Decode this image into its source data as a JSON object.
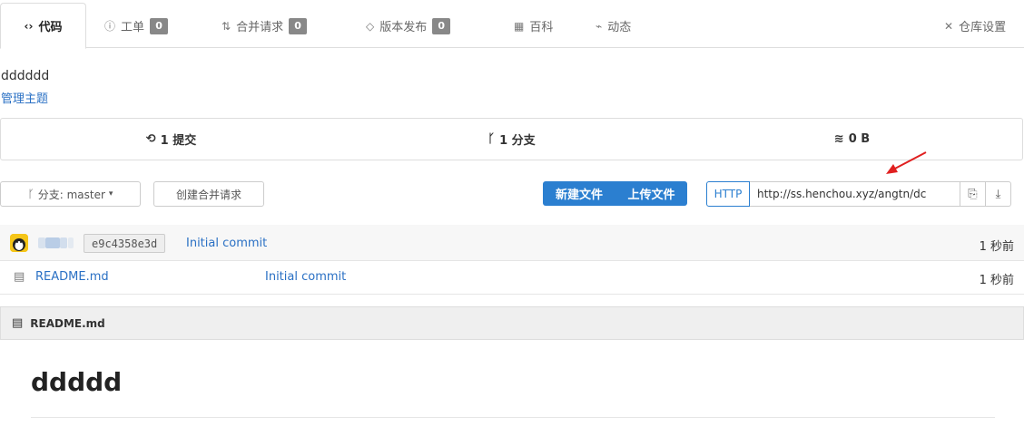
{
  "tabs": [
    {
      "icon": "code-icon",
      "glyph": "‹›",
      "label": "代码",
      "active": true
    },
    {
      "icon": "issue-icon",
      "glyph": "ⓘ",
      "label": "工单",
      "count": "0"
    },
    {
      "icon": "pull-request-icon",
      "glyph": "⇅",
      "label": "合并请求",
      "count": "0"
    },
    {
      "icon": "tag-icon",
      "glyph": "◇",
      "label": "版本发布",
      "count": "0"
    },
    {
      "icon": "wiki-icon",
      "glyph": "▦",
      "label": "百科"
    },
    {
      "icon": "activity-icon",
      "glyph": "⌁",
      "label": "动态"
    }
  ],
  "settings": {
    "icon": "tools-icon",
    "glyph": "✕",
    "label": "仓库设置"
  },
  "repo": {
    "description": "dddddd",
    "manage_topics": "管理主题"
  },
  "stats": {
    "commits": {
      "icon": "history-icon",
      "label": "1 提交"
    },
    "branches": {
      "icon": "branch-icon",
      "label": "1 分支"
    },
    "size": {
      "icon": "database-icon",
      "label": "0 B"
    }
  },
  "toolbar": {
    "branch_label": "分支: master",
    "create_pr": "创建合并请求",
    "new_file": "新建文件",
    "upload_file": "上传文件",
    "clone_protocol": "HTTP",
    "clone_url": "http://ss.henchou.xyz/angtn/dc"
  },
  "latest_commit": {
    "sha": "e9c4358e3d",
    "message": "Initial commit",
    "time": "1 秒前"
  },
  "files": [
    {
      "name": "README.md",
      "commit_message": "Initial commit",
      "time": "1 秒前"
    }
  ],
  "readme": {
    "filename": "README.md",
    "heading": "ddddd"
  },
  "colors": {
    "accent": "#2b7fd0",
    "link": "#2a70c4",
    "arrow": "#e02020"
  }
}
